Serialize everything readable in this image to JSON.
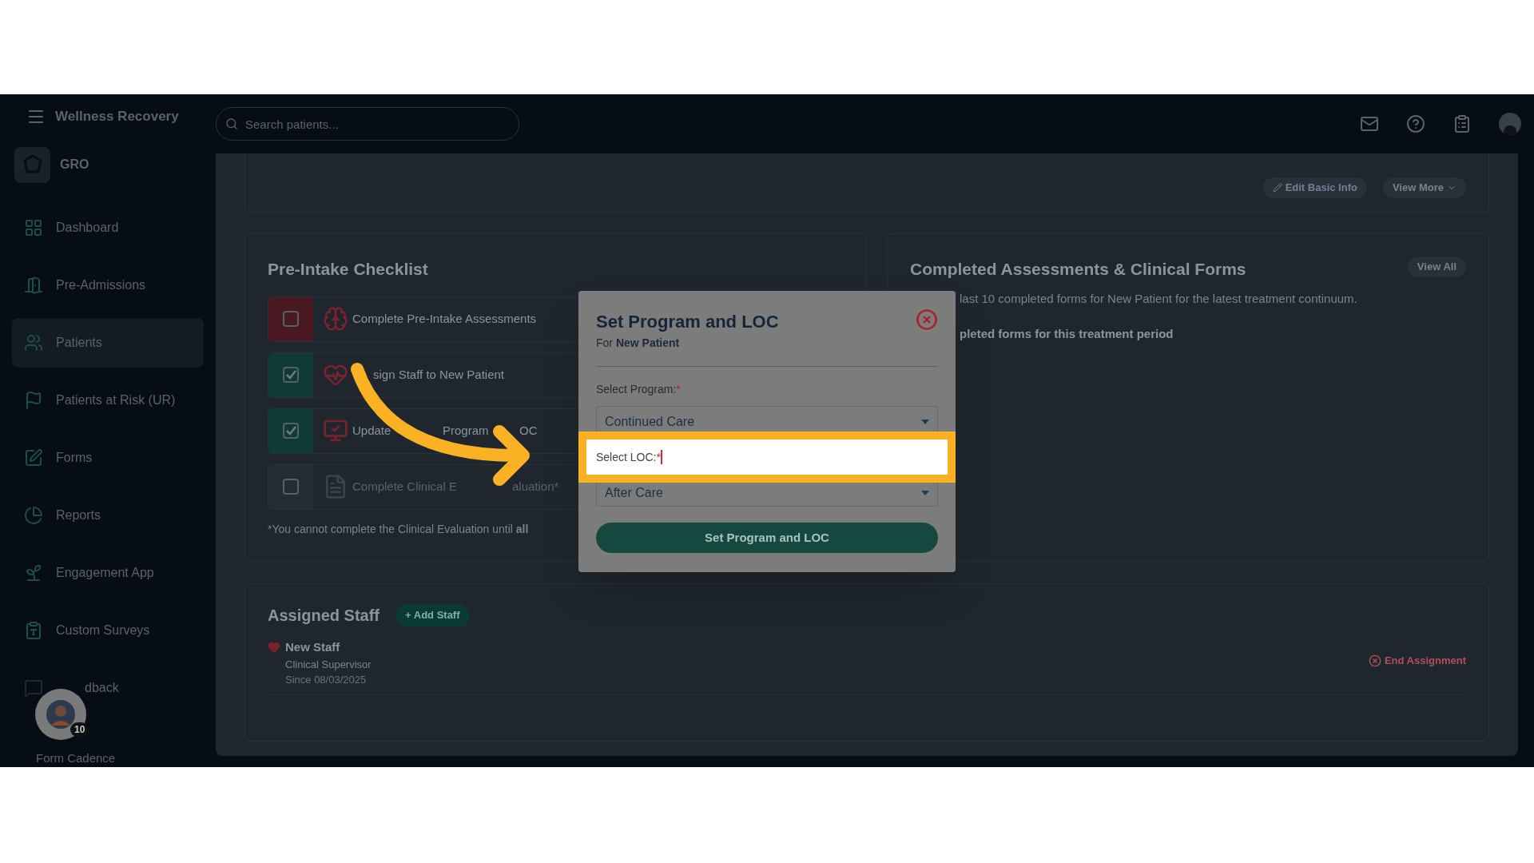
{
  "top_bar": {
    "app_name": "Wellness Recovery",
    "search": {
      "placeholder": "Search patients..."
    }
  },
  "sidebar": {
    "org": "GRO",
    "items": [
      {
        "label": "Dashboard",
        "selected": false
      },
      {
        "label": "Pre-Admissions",
        "selected": false
      },
      {
        "label": "Patients",
        "selected": true
      },
      {
        "label": "Patients at Risk (UR)",
        "selected": false
      },
      {
        "label": "Forms",
        "selected": false
      },
      {
        "label": "Reports",
        "selected": false
      },
      {
        "label": "Engagement App",
        "selected": false
      },
      {
        "label": "Custom Surveys",
        "selected": false
      }
    ],
    "partial_item": {
      "label": "dback"
    },
    "helper": {
      "badge": "10",
      "label": "Form Cadence"
    }
  },
  "patient_card": {
    "buttons": [
      "Edit Basic Info",
      "View More"
    ]
  },
  "checklist": {
    "title": "Pre-Intake Checklist",
    "items": [
      {
        "label_parts": [
          "Complete Pre-Intake Assessments"
        ],
        "checked": false,
        "disabled": false
      },
      {
        "label_parts": [
          "sign Staff to New Patient"
        ],
        "checked": true,
        "disabled": false
      },
      {
        "label_parts": [
          "Update",
          "Program",
          "OC"
        ],
        "checked": true,
        "disabled": false
      },
      {
        "label_parts": [
          "Complete Clinical E",
          "aluation*"
        ],
        "checked": false,
        "disabled": true
      }
    ],
    "footnote": "*You cannot complete the Clinical Evaluation until **all**"
  },
  "completed_forms": {
    "title": "Completed Assessments & Clinical Forms",
    "view_all": "View All",
    "description": "last 10 completed forms for New Patient for the latest treatment continuum.",
    "empty": "pleted forms for this treatment period"
  },
  "assigned_staff": {
    "title": "Assigned Staff",
    "add_button": "+ Add Staff",
    "staff": [
      {
        "name": "New Staff",
        "role": "Clinical Supervisor",
        "since": "Since 08/03/2025",
        "action": "End Assignment"
      }
    ]
  },
  "modal": {
    "title": "Set Program and LOC",
    "subtitle": "For **New Patient**",
    "program_label": "Select Program:",
    "program_value": "Continued Care",
    "loc_label": "Select LOC:",
    "loc_value": "After Care",
    "required_mark": "*",
    "submit": "Set Program and LOC"
  }
}
